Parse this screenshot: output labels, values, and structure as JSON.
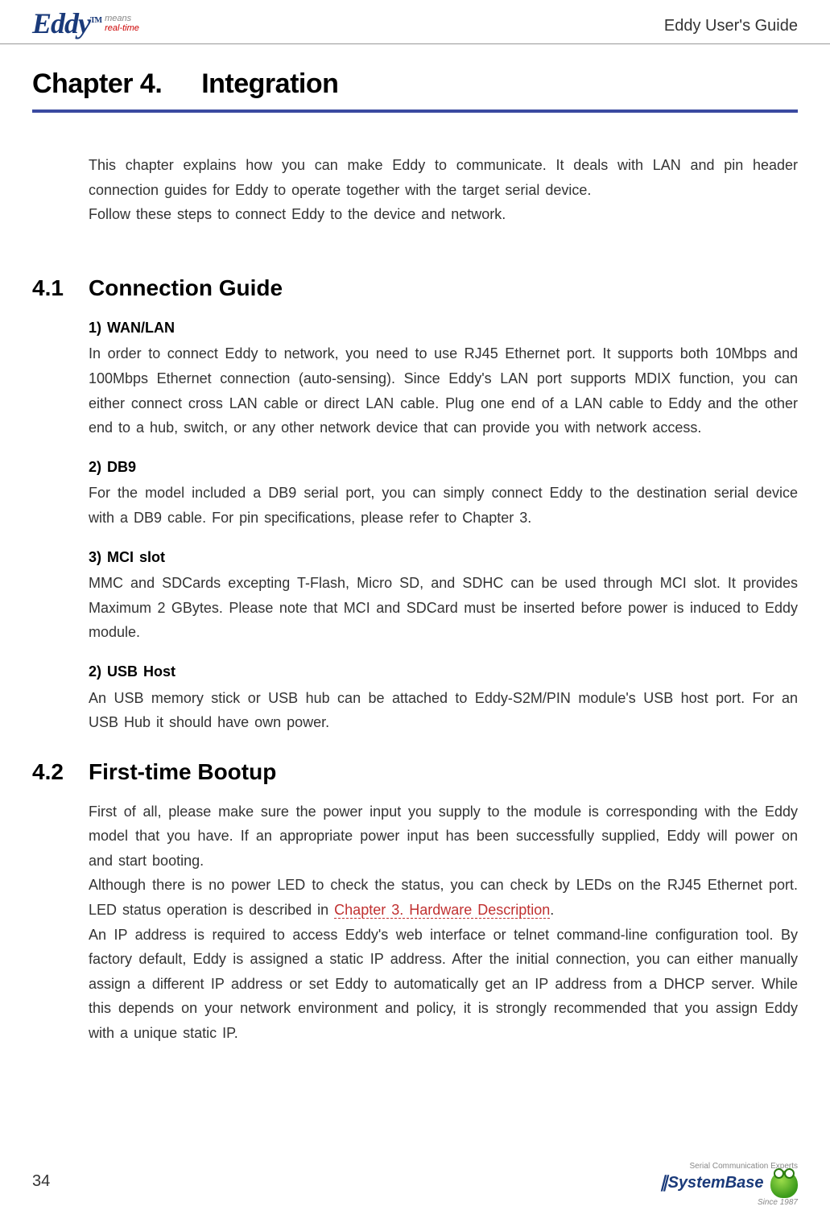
{
  "header": {
    "logo_text": "Eddy",
    "logo_tm": "TM",
    "logo_sub_means": "means",
    "logo_sub_rt": "real-time",
    "guide_title": "Eddy User's Guide"
  },
  "chapter": {
    "number": "Chapter 4.",
    "title": "Integration"
  },
  "intro": {
    "p1": "This chapter explains how you can make Eddy to communicate. It deals with LAN and pin header connection guides for Eddy to operate together with the target serial device.",
    "p2": "Follow these steps to connect Eddy to the device and network."
  },
  "sections": {
    "s41": {
      "num": "4.1",
      "title": "Connection Guide",
      "items": {
        "wan": {
          "title": "1) WAN/LAN",
          "body": "In order to connect Eddy to network, you need to use RJ45 Ethernet port. It supports both 10Mbps and 100Mbps Ethernet connection (auto-sensing). Since Eddy's LAN port supports MDIX function, you can either connect cross LAN cable or direct LAN cable. Plug one end of a LAN cable to Eddy and the other end to a hub, switch, or any other network device that can provide you with network access."
        },
        "db9": {
          "title": "2) DB9",
          "body": "For the model included a DB9 serial port, you can simply connect Eddy to the destination serial device with a DB9 cable. For pin specifications, please refer to Chapter 3."
        },
        "mci": {
          "title": "3) MCI slot",
          "body": "MMC and SDCards excepting T-Flash, Micro SD, and SDHC can be used through MCI slot. It provides Maximum 2 GBytes. Please note that MCI and SDCard must be inserted before power is induced to Eddy module."
        },
        "usb": {
          "title": "2) USB Host",
          "body": "An USB memory stick or USB hub can be attached to Eddy-S2M/PIN module's USB host port. For an USB Hub it should have own power."
        }
      }
    },
    "s42": {
      "num": "4.2",
      "title": "First-time Bootup",
      "p1": "First of all, please make sure the power input you supply to the module is corresponding with the Eddy model that you have. If an appropriate power input has been successfully supplied, Eddy will power on and start booting.",
      "p2a": "Although there is no power LED to check the status, you can check by LEDs on the RJ45 Ethernet port. LED status operation is described in ",
      "p2link": "Chapter 3. Hardware Description",
      "p2b": ".",
      "p3": "An IP address is required to access Eddy's web interface or telnet command-line configuration tool. By factory default, Eddy is assigned a static IP address. After the initial connection, you can either manually assign a different IP address or set Eddy to automatically get an IP address from a DHCP server. While this depends on your network environment and policy, it is strongly recommended that you assign Eddy with a unique static IP."
    }
  },
  "footer": {
    "page_num": "34",
    "tag": "Serial Communication Experts",
    "brand": "SystemBase",
    "since": "Since 1987"
  }
}
